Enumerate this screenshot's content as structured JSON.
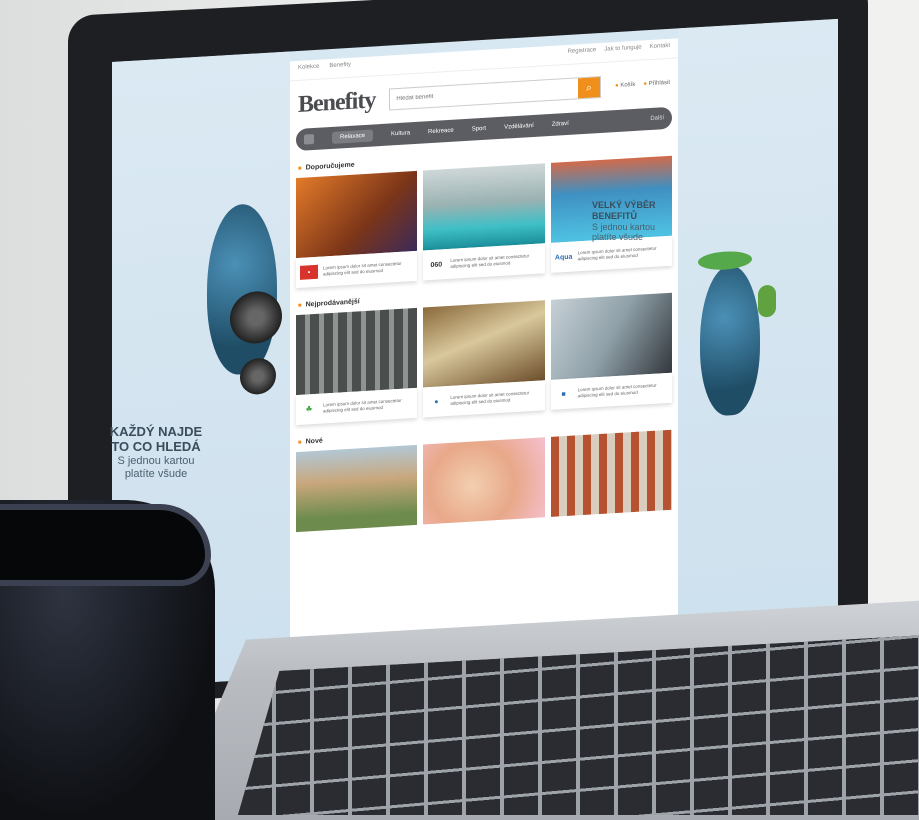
{
  "site": {
    "logo": "Benefity",
    "topbar": {
      "lang": [
        "Kolekce",
        "Benefity"
      ],
      "links": [
        "Registrace",
        "Jak to funguje",
        "Kontakt"
      ]
    },
    "search_placeholder": "Hledat benefit",
    "header_links": [
      "Košík",
      "Přihlásit"
    ],
    "nav": {
      "items": [
        "Relaxace",
        "Kultura",
        "Rekreace",
        "Sport",
        "Vzdělávání",
        "Zdraví"
      ],
      "extra": "Další"
    },
    "sections": [
      {
        "title": "Doporučujeme",
        "cards": [
          {
            "logo": "▪",
            "text": "Lorem ipsum dolor sit amet consectetur adipiscing elit sed do eiusmod"
          },
          {
            "logo": "060",
            "text": "Lorem ipsum dolor sit amet consectetur adipiscing elit sed do eiusmod"
          },
          {
            "logo": "Aqua",
            "text": "Lorem ipsum dolor sit amet consectetur adipiscing elit sed do eiusmod"
          }
        ]
      },
      {
        "title": "Nejprodávanější",
        "cards": [
          {
            "logo": "☘",
            "text": "Lorem ipsum dolor sit amet consectetur adipiscing elit sed do eiusmod"
          },
          {
            "logo": "●",
            "text": "Lorem ipsum dolor sit amet consectetur adipiscing elit sed do eiusmod"
          },
          {
            "logo": "■",
            "text": "Lorem ipsum dolor sit amet consectetur adipiscing elit sed do eiusmod"
          }
        ]
      },
      {
        "title": "Nové",
        "cards": [
          {
            "logo": "",
            "text": ""
          },
          {
            "logo": "",
            "text": ""
          },
          {
            "logo": "",
            "text": ""
          }
        ]
      }
    ]
  },
  "promo_left": {
    "line1": "KAŽDÝ NAJDE",
    "line2": "TO CO HLEDÁ",
    "sub1": "S jednou kartou",
    "sub2": "platíte všude"
  },
  "promo_right": {
    "line1": "VELKÝ VÝBĚR",
    "line2": "BENEFITŮ",
    "sub1": "S jednou kartou",
    "sub2": "platíte všude"
  },
  "colors": {
    "accent": "#f18f1d",
    "nav": "#5b5d62"
  }
}
